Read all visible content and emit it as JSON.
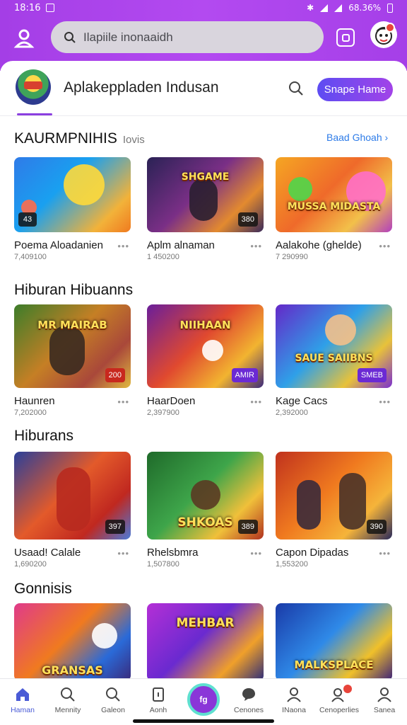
{
  "status": {
    "time": "18:16",
    "battery": "68.36%"
  },
  "search": {
    "placeholder": "Ilapiile inonaaidh"
  },
  "app": {
    "title": "Aplakeppladen Indusan",
    "cta": "Snape Hame"
  },
  "sections": [
    {
      "title": "KAURMPNIHIS",
      "subtitle": "Iovis",
      "see_all": "Baad Ghoah ›",
      "items": [
        {
          "name": "Poema Aloadanien",
          "meta": "7,409100",
          "badge": "43",
          "label": ""
        },
        {
          "name": "Aplm alnaman",
          "meta": "1 450200",
          "badge": "380",
          "label": "SHGAME"
        },
        {
          "name": "Aalakohe (ghelde)",
          "meta": "7 290990",
          "badge": "",
          "label": "MUSSA MIDASTA"
        }
      ]
    },
    {
      "title": "Hiburan Hibuanns",
      "subtitle": "",
      "see_all": "",
      "items": [
        {
          "name": "Haunren",
          "meta": "7,202000",
          "badge": "200",
          "label": "MR MAIRAB"
        },
        {
          "name": "HaarDoen",
          "meta": "2,397900",
          "badge": "AMIR",
          "label": "NIIHAAN"
        },
        {
          "name": "Kage Cacs",
          "meta": "2,392000",
          "badge": "SMEB",
          "label": "SAUE SAIIBNS"
        }
      ]
    },
    {
      "title": "Hiburans",
      "subtitle": "",
      "see_all": "",
      "items": [
        {
          "name": "Usaad! Calale",
          "meta": "1,690200",
          "badge": "397",
          "label": ""
        },
        {
          "name": "Rhelsbmra",
          "meta": "1,507800",
          "badge": "389",
          "label": "SHKOAS"
        },
        {
          "name": "Capon Dipadas",
          "meta": "1,553200",
          "badge": "390",
          "label": ""
        }
      ]
    },
    {
      "title": "Gonnisis",
      "subtitle": "",
      "see_all": "",
      "items": [
        {
          "name": "",
          "meta": "",
          "badge": "",
          "label": "GRANSAS"
        },
        {
          "name": "",
          "meta": "",
          "badge": "",
          "label": "MEHBAR"
        },
        {
          "name": "",
          "meta": "",
          "badge": "",
          "label": "MALKSPLACE"
        }
      ]
    }
  ],
  "nav": [
    {
      "label": "Haman",
      "icon": "home-icon"
    },
    {
      "label": "Mennity",
      "icon": "search-icon"
    },
    {
      "label": "Galeon",
      "icon": "search-icon"
    },
    {
      "label": "Aonh",
      "icon": "document-icon"
    },
    {
      "label": "fg",
      "icon": "center-action-icon"
    },
    {
      "label": "Cenones",
      "icon": "chat-icon"
    },
    {
      "label": "INaona",
      "icon": "person-icon"
    },
    {
      "label": "Cenoperlies",
      "icon": "people-icon"
    },
    {
      "label": "Sanea",
      "icon": "user-icon"
    }
  ],
  "colors": {
    "header": "#a43ee6",
    "accent": "#5d4cf2",
    "link": "#2e7ce8",
    "nav_active": "#4a5bd6"
  }
}
